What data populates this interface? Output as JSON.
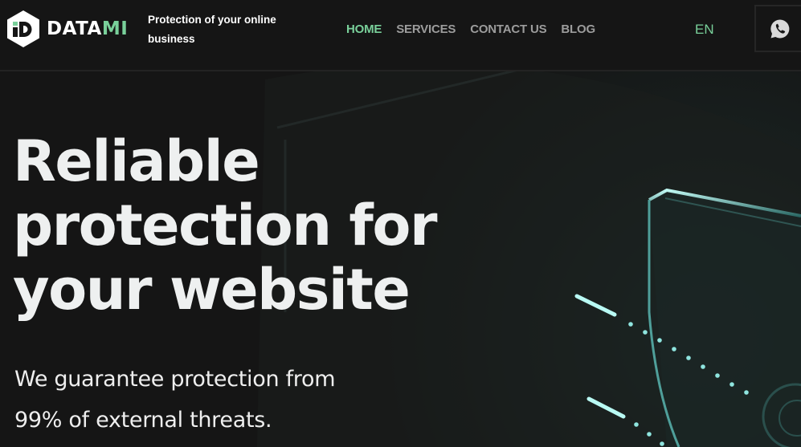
{
  "brand": {
    "name_main": "DATA",
    "name_accent": "MI",
    "tagline": "Protection of your online business"
  },
  "nav": {
    "items": [
      {
        "label": "HOME",
        "active": true
      },
      {
        "label": "SERVICES",
        "active": false
      },
      {
        "label": "CONTACT US",
        "active": false
      },
      {
        "label": "BLOG",
        "active": false
      }
    ]
  },
  "language": "EN",
  "contact": {
    "icon": "whatsapp-icon"
  },
  "hero": {
    "title_lines": [
      "Reliable",
      "protection for",
      "your website"
    ],
    "subtitle": "We guarantee protection from 99% of external threats."
  },
  "colors": {
    "accent": "#79d09a",
    "background": "#151515",
    "glow": "#6fe0e0"
  }
}
